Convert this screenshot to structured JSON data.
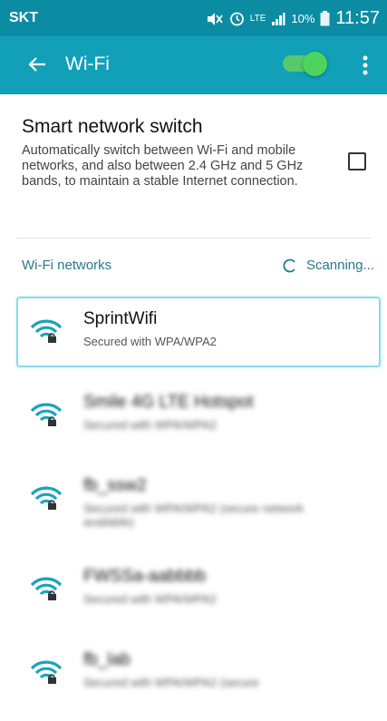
{
  "status_bar": {
    "carrier": "SKT",
    "network": "LTE",
    "battery": "10%",
    "time": "11:57",
    "icons": [
      "mute-icon",
      "alarm-icon",
      "lte-icon",
      "signal-icon",
      "battery-icon"
    ]
  },
  "app_bar": {
    "title": "Wi-Fi",
    "wifi_enabled": true,
    "icons": [
      "back-arrow-icon",
      "toggle-switch",
      "overflow-menu-icon"
    ]
  },
  "smart_switch": {
    "title": "Smart network switch",
    "description": "Automatically switch between Wi-Fi and mobile networks, and also between 2.4 GHz and 5 GHz bands, to maintain a stable Internet connection.",
    "checked": false
  },
  "networks_section": {
    "header": "Wi-Fi networks",
    "status": "Scanning..."
  },
  "networks": [
    {
      "name": "SprintWifi",
      "security": "Secured with WPA/WPA2",
      "selected": true
    },
    {
      "name": "Smile 4G LTE Hotspot",
      "security": "Secured with WPA/WPA2",
      "selected": false
    },
    {
      "name": "fb_ssw2",
      "security": "Secured with WPA/WPA2 (secure network available)",
      "selected": false
    },
    {
      "name": "FWSSa-aabbbb",
      "security": "Secured with WPA/WPA2",
      "selected": false
    },
    {
      "name": "fb_lab",
      "security": "Secured with WPA/WPA2 (secure",
      "selected": false
    }
  ],
  "colors": {
    "status_bar": "#0b8ca3",
    "app_bar": "#11a0b8",
    "toggle_on": "#4cd45c",
    "accent_text": "#27798a",
    "wifi_icon": "#1aa3bd"
  }
}
